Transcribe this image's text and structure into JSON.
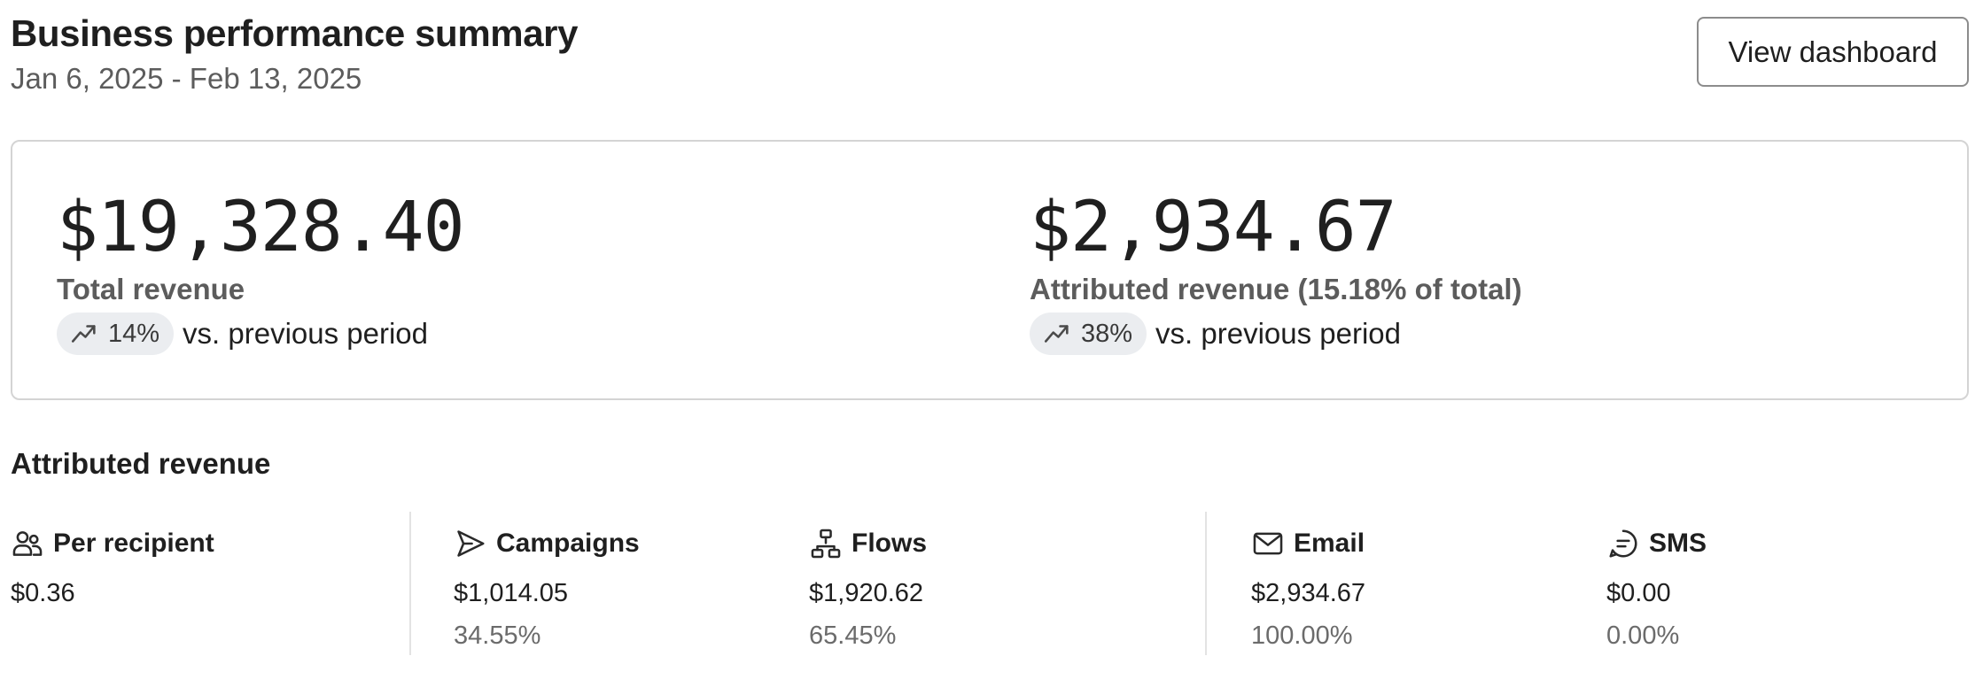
{
  "header": {
    "title": "Business performance summary",
    "date_range": "Jan 6, 2025 - Feb 13, 2025",
    "view_dashboard_label": "View dashboard"
  },
  "summary": {
    "total": {
      "value": "$19,328.40",
      "label": "Total revenue",
      "change": "14%",
      "change_text": "vs. previous period",
      "trend_icon": "trending-up-icon"
    },
    "attributed": {
      "value": "$2,934.67",
      "label": "Attributed revenue (15.18% of total)",
      "change": "38%",
      "change_text": "vs. previous period",
      "trend_icon": "trending-up-icon"
    }
  },
  "attributed_section": {
    "title": "Attributed revenue",
    "stats": [
      {
        "label": "Per recipient",
        "value": "$0.36",
        "percent": "",
        "icon": "users-icon"
      },
      {
        "label": "Campaigns",
        "value": "$1,014.05",
        "percent": "34.55%",
        "icon": "send-icon"
      },
      {
        "label": "Flows",
        "value": "$1,920.62",
        "percent": "65.45%",
        "icon": "flow-icon"
      },
      {
        "label": "Email",
        "value": "$2,934.67",
        "percent": "100.00%",
        "icon": "mail-icon"
      },
      {
        "label": "SMS",
        "value": "$0.00",
        "percent": "0.00%",
        "icon": "chat-icon"
      }
    ]
  },
  "colors": {
    "text": "#1f1f1f",
    "muted": "#5c5c5c",
    "badge_bg": "#ebedf0",
    "border": "#d4d4d4"
  }
}
